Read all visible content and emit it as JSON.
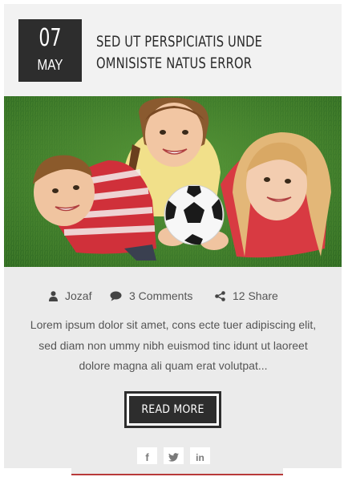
{
  "post": {
    "date": {
      "day": "07",
      "month": "May"
    },
    "title": "Sed ut perspiciatis unde omnisiste natus error",
    "image": {
      "description_icon": "kids-soccer-photo"
    },
    "meta": {
      "author": "Jozaf",
      "comments": "3 Comments",
      "shares": "12 Share"
    },
    "excerpt": "Lorem ipsum dolor sit amet, cons ecte tuer adipiscing elit, sed diam non ummy nibh euismod tinc idunt ut laoreet dolore magna ali quam erat volutpat...",
    "read_more_label": "Read More",
    "social": [
      {
        "icon": "facebook-icon",
        "glyph": "f"
      },
      {
        "icon": "twitter-icon",
        "glyph": "t"
      },
      {
        "icon": "linkedin-icon",
        "glyph": "in"
      }
    ]
  },
  "colors": {
    "dark": "#2d2d2d",
    "header_bg": "#f2f2f2",
    "body_bg": "#ebebeb",
    "text": "#555555",
    "accent_line": "#b83a3a"
  }
}
